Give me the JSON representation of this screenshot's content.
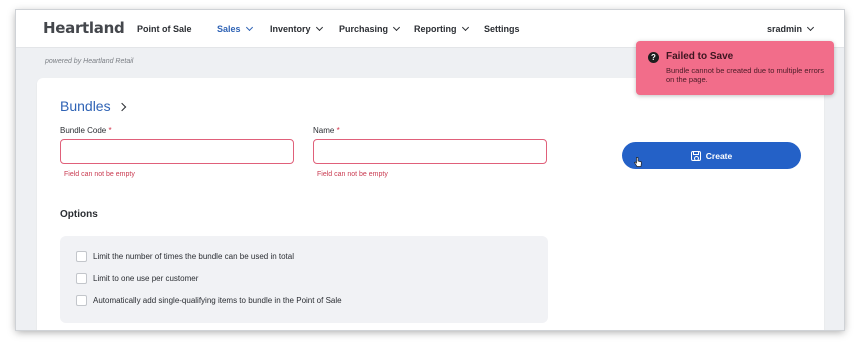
{
  "nav": {
    "logo": "Heartland",
    "items": [
      "Point of Sale",
      "Sales",
      "Inventory",
      "Purchasing",
      "Reporting",
      "Settings"
    ],
    "user": "sradmin"
  },
  "powered_by": "powered by Heartland Retail",
  "toast": {
    "icon": "question-circle-icon",
    "title": "Failed to Save",
    "message": "Bundle cannot be created due to multiple errors on the page."
  },
  "page": {
    "title": "Bundles"
  },
  "form": {
    "bundle_code": {
      "label": "Bundle Code",
      "required_mark": "*",
      "value": "",
      "error": "Field can not be empty"
    },
    "name": {
      "label": "Name",
      "required_mark": "*",
      "value": "",
      "error": "Field can not be empty"
    },
    "create_label": "Create"
  },
  "options": {
    "title": "Options",
    "items": [
      "Limit the number of times the bundle can be used in total",
      "Limit to one use per customer",
      "Automatically add single-qualifying items to bundle in the Point of Sale"
    ]
  },
  "colors": {
    "accent": "#2f63b5",
    "button": "#2461c7",
    "toast": "#f26d8a",
    "error": "#c93a50"
  }
}
